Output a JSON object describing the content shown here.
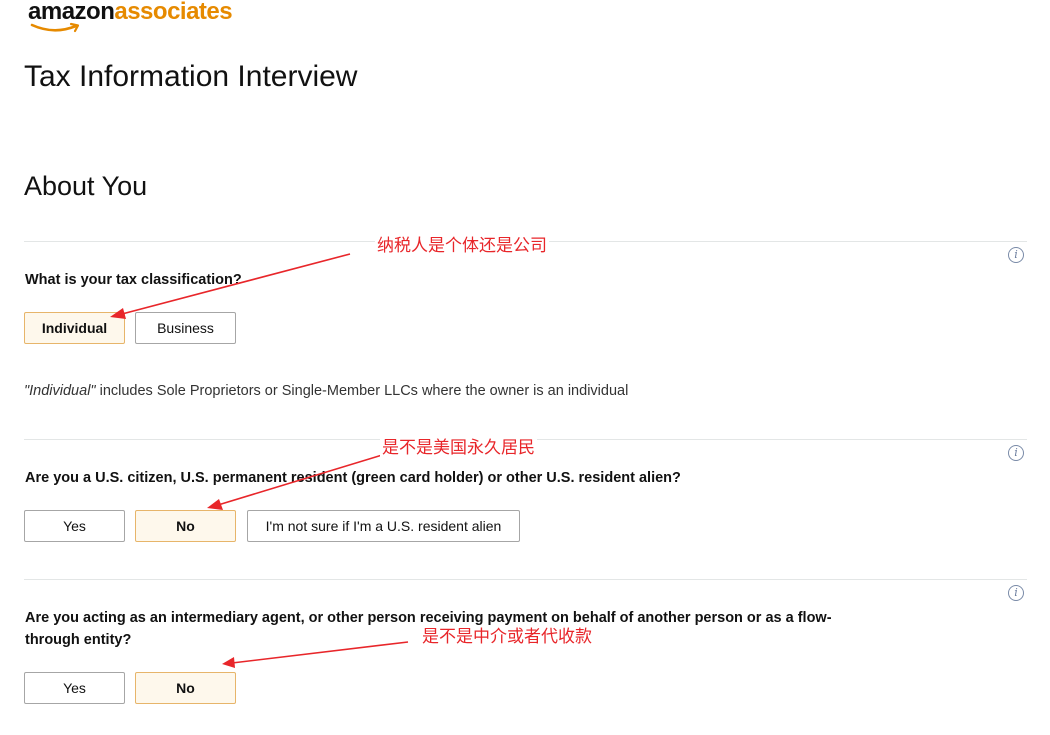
{
  "logo": {
    "part1": "amazon",
    "part2": "associates"
  },
  "page_title": "Tax Information Interview",
  "section_title": "About You",
  "info_glyph": "i",
  "q1": {
    "question": "What is your tax classification?",
    "options": [
      "Individual",
      "Business"
    ],
    "selected": "Individual",
    "note_italic": "\"Individual\"",
    "note_rest": " includes Sole Proprietors or Single-Member LLCs where the owner is an individual"
  },
  "q2": {
    "question": "Are you a U.S. citizen, U.S. permanent resident (green card holder) or other U.S. resident alien?",
    "options": [
      "Yes",
      "No",
      "I'm not sure if I'm a U.S. resident alien"
    ],
    "selected": "No"
  },
  "q3": {
    "question_line1": "Are you acting as an intermediary agent, or other person receiving payment on behalf of another person or as a flow-",
    "question_line2": "through entity?",
    "options": [
      "Yes",
      "No"
    ],
    "selected": "No"
  },
  "annotations": {
    "a1": "纳税人是个体还是公司",
    "a2": "是不是美国永久居民",
    "a3": "是不是中介或者代收款"
  },
  "colors": {
    "accent": "#e68a00",
    "annotation": "#e8262a",
    "selected_bg": "#fef8ec",
    "selected_border": "#e7b56a"
  },
  "icons": [
    "amazon-smile-icon",
    "info-icon"
  ]
}
